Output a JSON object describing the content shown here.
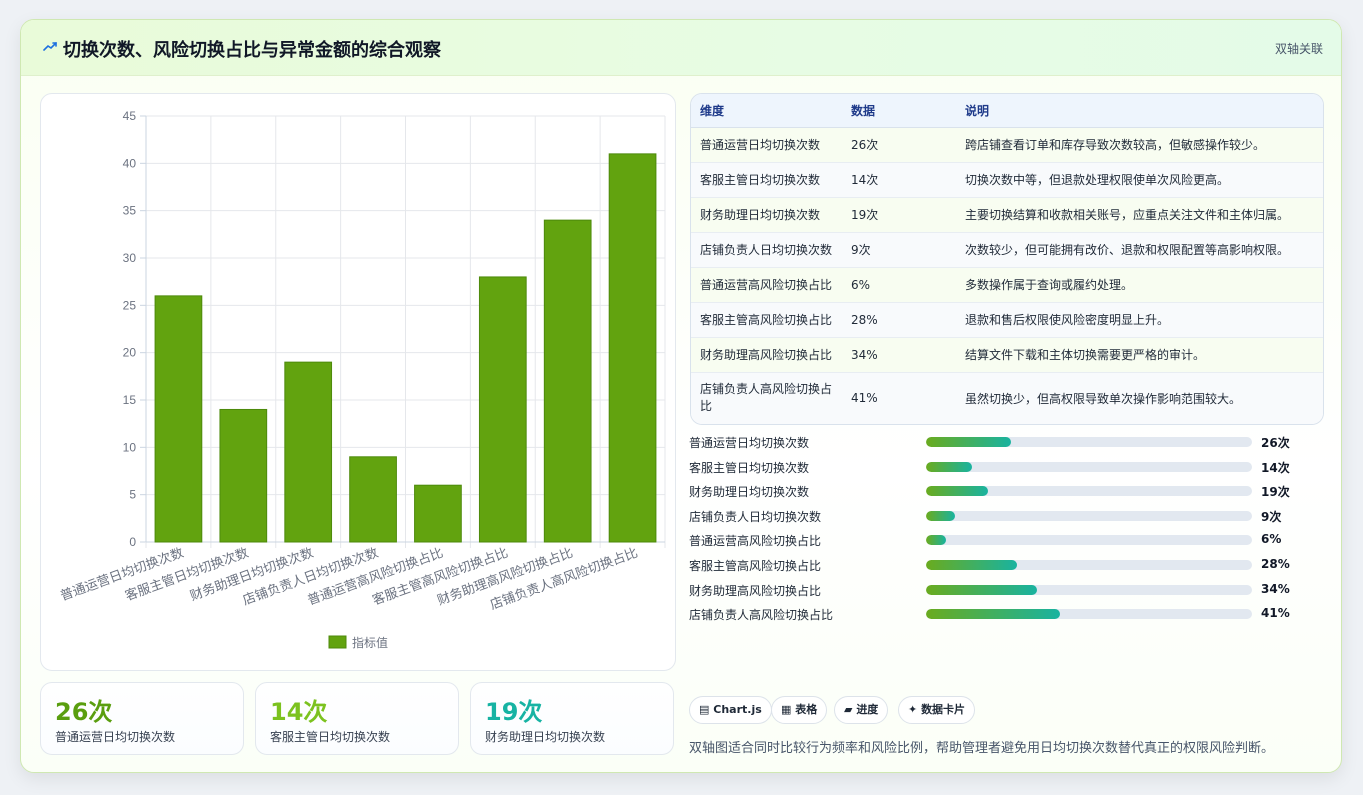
{
  "header": {
    "title": "切换次数、风险切换占比与异常金额的综合观察",
    "tag": "双轴关联"
  },
  "chart_data": {
    "type": "bar",
    "categories": [
      "普通运营日均切换次数",
      "客服主管日均切换次数",
      "财务助理日均切换次数",
      "店铺负责人日均切换次数",
      "普通运营高风险切换占比",
      "客服主管高风险切换占比",
      "财务助理高风险切换占比",
      "店铺负责人高风险切换占比"
    ],
    "series": [
      {
        "name": "指标值",
        "values": [
          26,
          14,
          19,
          9,
          6,
          28,
          34,
          41
        ],
        "color": "#62a30f"
      }
    ],
    "ylim": [
      0,
      45
    ],
    "yticks": [
      0,
      5,
      10,
      15,
      20,
      25,
      30,
      35,
      40,
      45
    ],
    "grid": true,
    "legend": "bottom"
  },
  "kpis": [
    {
      "value": "26次",
      "label": "普通运营日均切换次数",
      "color": "#5a9e0f"
    },
    {
      "value": "14次",
      "label": "客服主管日均切换次数",
      "color": "#7cc21f"
    },
    {
      "value": "19次",
      "label": "财务助理日均切换次数",
      "color": "#17b3a3"
    }
  ],
  "table": {
    "headers": [
      "维度",
      "数据",
      "说明"
    ],
    "rows": [
      [
        "普通运营日均切换次数",
        "26次",
        "跨店铺查看订单和库存导致次数较高，但敏感操作较少。"
      ],
      [
        "客服主管日均切换次数",
        "14次",
        "切换次数中等，但退款处理权限使单次风险更高。"
      ],
      [
        "财务助理日均切换次数",
        "19次",
        "主要切换结算和收款相关账号，应重点关注文件和主体归属。"
      ],
      [
        "店铺负责人日均切换次数",
        "9次",
        "次数较少，但可能拥有改价、退款和权限配置等高影响权限。"
      ],
      [
        "普通运营高风险切换占比",
        "6%",
        "多数操作属于查询或履约处理。"
      ],
      [
        "客服主管高风险切换占比",
        "28%",
        "退款和售后权限使风险密度明显上升。"
      ],
      [
        "财务助理高风险切换占比",
        "34%",
        "结算文件下载和主体切换需要更严格的审计。"
      ],
      [
        "店铺负责人高风险切换占比",
        "41%",
        "虽然切换少，但高权限导致单次操作影响范围较大。"
      ]
    ]
  },
  "progress": [
    {
      "label": "普通运营日均切换次数",
      "display": "26次",
      "fraction": 0.26
    },
    {
      "label": "客服主管日均切换次数",
      "display": "14次",
      "fraction": 0.14
    },
    {
      "label": "财务助理日均切换次数",
      "display": "19次",
      "fraction": 0.19
    },
    {
      "label": "店铺负责人日均切换次数",
      "display": "9次",
      "fraction": 0.09
    },
    {
      "label": "普通运营高风险切换占比",
      "display": "6%",
      "fraction": 0.06
    },
    {
      "label": "客服主管高风险切换占比",
      "display": "28%",
      "fraction": 0.28
    },
    {
      "label": "财务助理高风险切换占比",
      "display": "34%",
      "fraction": 0.34
    },
    {
      "label": "店铺负责人高风险切换占比",
      "display": "41%",
      "fraction": 0.41
    }
  ],
  "chips": [
    {
      "icon": "chart-icon",
      "label": "Chart.js"
    },
    {
      "icon": "table-icon",
      "label": "表格"
    },
    {
      "icon": "progress-icon",
      "label": "进度"
    },
    {
      "icon": "sparkle-icon",
      "label": "数据卡片"
    }
  ],
  "footnote": "双轴图适合同时比较行为频率和风险比例，帮助管理者避免用日均切换次数替代真正的权限风险判断。"
}
